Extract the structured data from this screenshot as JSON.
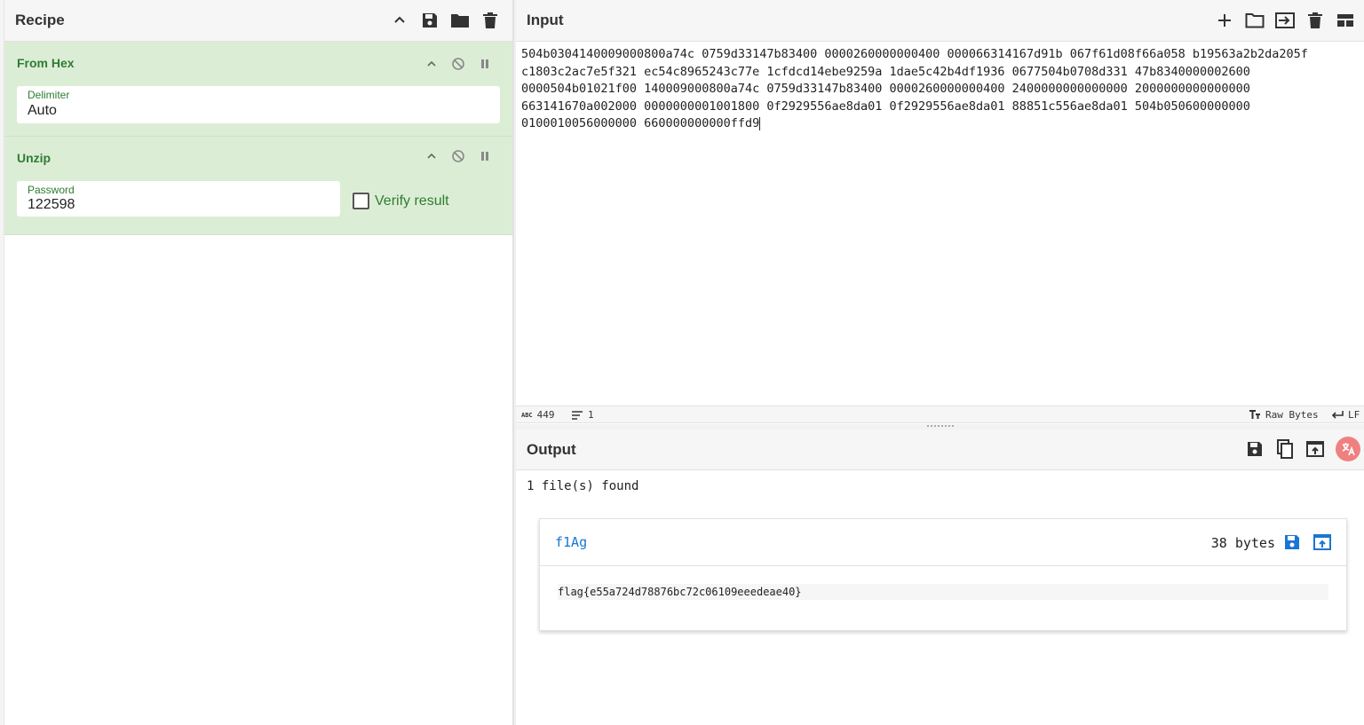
{
  "recipe": {
    "title": "Recipe",
    "operations": [
      {
        "name": "From Hex",
        "field_label": "Delimiter",
        "field_value": "Auto"
      },
      {
        "name": "Unzip",
        "field_label": "Password",
        "field_value": "122598",
        "checkbox_label": "Verify result",
        "checkbox_checked": false
      }
    ]
  },
  "input": {
    "title": "Input",
    "lines": [
      "504b0304140009000800a74c 0759d33147b83400 0000260000000400 000066314167d91b 067f61d08f66a058 b19563a2b2da205f",
      "c1803c2ac7e5f321 ec54c8965243c77e 1cfdcd14ebe9259a 1dae5c42b4df1936 0677504b0708d331 47b8340000002600",
      "0000504b01021f00 140009000800a74c 0759d33147b83400 0000260000000400 2400000000000000 2000000000000000",
      "663141670a002000 0000000001001800 0f2929556ae8da01 0f2929556ae8da01 88851c556ae8da01 504b050600000000",
      "0100010056000000 660000000000ffd9"
    ],
    "status": {
      "char_label": "ABC",
      "char_count": "449",
      "line_count": "1",
      "encoding": "Raw Bytes",
      "eol": "LF"
    }
  },
  "output": {
    "title": "Output",
    "summary": "1 file(s) found",
    "file": {
      "name": "f1Ag",
      "size": "38 bytes",
      "content": "flag{e55a724d78876bc72c06109eeedeae40}"
    }
  },
  "colors": {
    "op_bg": "#dcedd6",
    "op_text": "#2e7d32",
    "link_blue": "#1976d2"
  }
}
